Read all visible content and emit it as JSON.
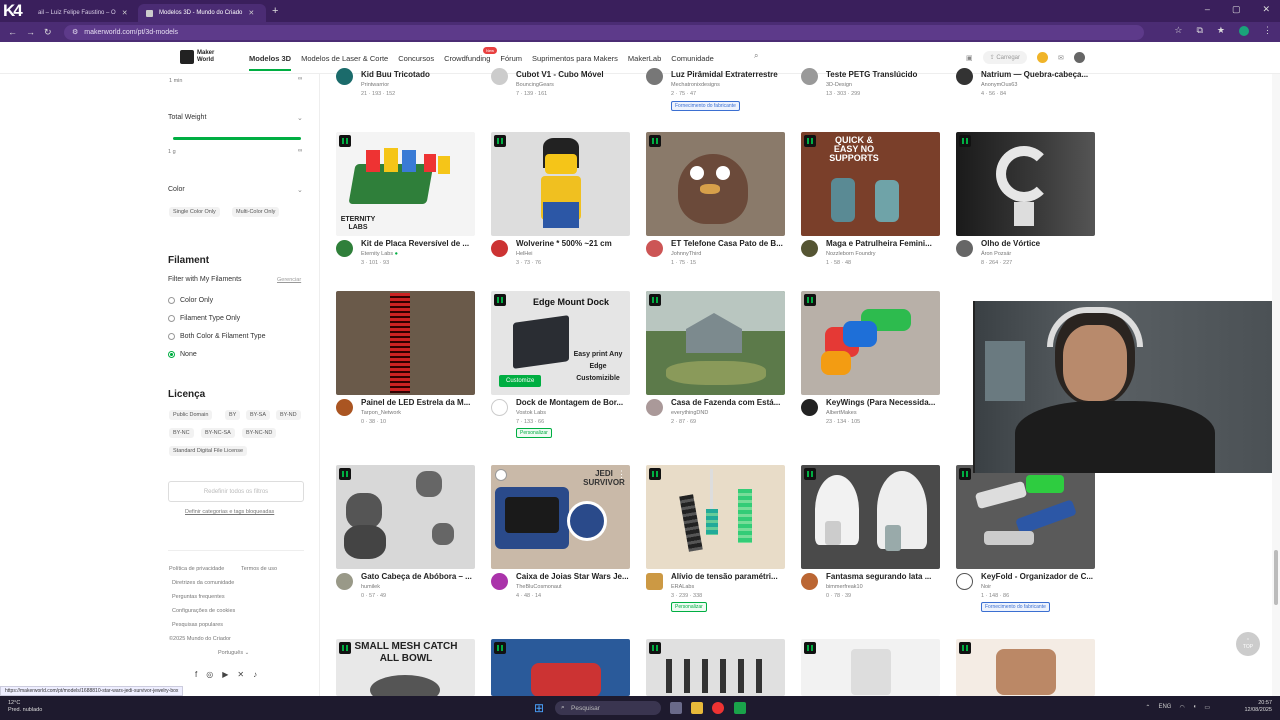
{
  "browser": {
    "tabs": [
      {
        "label": "ail – Luiz Felipe Faustino – O"
      },
      {
        "label": "Modelos 3D - Mundo do Criado"
      }
    ],
    "url": "makerworld.com/pt/3d-models"
  },
  "overlay_logo": "K4",
  "site": {
    "logo_line1": "Maker",
    "logo_line2": "World",
    "menu": [
      "Modelos 3D",
      "Modelos de Laser & Corte",
      "Concursos",
      "Crowdfunding",
      "Fórum",
      "Suprimentos para Makers",
      "MakerLab",
      "Comunidade"
    ],
    "new_badge": "New",
    "upload_label": "Carregar"
  },
  "sidebar": {
    "top_min": "1 min",
    "total_weight": "Total Weight",
    "weight_min": "1 g",
    "color": "Color",
    "color_chips": [
      "Single Color Only",
      "Multi-Color Only"
    ],
    "filament": "Filament",
    "filter_my": "Filter with My Filaments",
    "manage": "Gerenciar",
    "filament_options": [
      {
        "label": "Color Only",
        "selected": false
      },
      {
        "label": "Filament Type Only",
        "selected": false
      },
      {
        "label": "Both Color & Filament Type",
        "selected": false
      },
      {
        "label": "None",
        "selected": true
      }
    ],
    "license": "Licença",
    "license_chips": [
      "Public Domain",
      "BY",
      "BY-SA",
      "BY-ND",
      "BY-NC",
      "BY-NC-SA",
      "BY-NC-ND",
      "Standard Digital File License"
    ],
    "reset": "Redefinir todos os filtros",
    "define_blocked": "Definir categorias e tags bloqueadas",
    "footer_links": [
      "Política de privacidade",
      "Termos de uso",
      "Diretrizes da comunidade",
      "Perguntas frequentes",
      "Configurações de cookies",
      "Pesquisas populares"
    ],
    "copyright": "©2025 Mundo do Criador",
    "language": "Português"
  },
  "top_row": [
    {
      "title": "Kid Buu Tricotado",
      "author": "Printwarrior",
      "stats": "21 · 193 · 152",
      "tag": ""
    },
    {
      "title": "Cubot V1 - Cubo Móvel",
      "author": "BouncingGears",
      "stats": "7 · 139 · 161",
      "tag": ""
    },
    {
      "title": "Luz Pirâmidal Extraterrestre",
      "author": "Mechatronixdesigns",
      "stats": "2 · 75 · 47",
      "tag": "Fornecimento do fabricante"
    },
    {
      "title": "Teste PETG Translúcido",
      "author": "3D-Design",
      "stats": "13 · 303 · 299",
      "tag": ""
    },
    {
      "title": "Natrium — Quebra-cabeça...",
      "author": "AnonymOus63",
      "stats": "4 · 56 · 84",
      "tag": ""
    }
  ],
  "cards": [
    {
      "title": "Kit de Placa Reversível de ...",
      "author": "Eternity Labs",
      "stats": "3 · 101 · 93",
      "tag": "",
      "overlay": "ETERNITY LABS"
    },
    {
      "title": "Wolverine * 500% ~21 cm",
      "author": "HelHei",
      "stats": "3 · 73 · 76",
      "tag": "",
      "overlay": ""
    },
    {
      "title": "ET Telefone Casa Pato de B...",
      "author": "JohnnyThird",
      "stats": "1 · 75 · 15",
      "tag": "",
      "overlay": ""
    },
    {
      "title": "Maga e Patrulheira Femini...",
      "author": "Nozzleborn Foundry",
      "stats": "1 · 58 · 48",
      "tag": "",
      "overlay": "QUICK & EASY NO SUPPORTS"
    },
    {
      "title": "Olho de Vórtice",
      "author": "Áron Pozsár",
      "stats": "8 · 264 · 227",
      "tag": "",
      "overlay": ""
    },
    {
      "title": "Painel de LED Estrela da M...",
      "author": "Tarpon_Network",
      "stats": "0 · 38 · 10",
      "tag": "",
      "overlay": ""
    },
    {
      "title": "Dock de Montagem de Bor...",
      "author": "Vostok Labs",
      "stats": "7 · 133 · 66",
      "tag": "Personalizar",
      "overlay": "Edge Mount Dock",
      "customize": "Customize",
      "sub": "Easy print Any Edge Customizible"
    },
    {
      "title": "Casa de Fazenda com Está...",
      "author": "everythingDND",
      "stats": "2 · 87 · 69",
      "tag": "",
      "overlay": ""
    },
    {
      "title": "KeyWings (Para Necessida...",
      "author": "AlbertMakes",
      "stats": "23 · 134 · 105",
      "tag": "",
      "overlay": ""
    },
    {
      "title": "Gato Cabeça de Abóbora – ...",
      "author": "humilek",
      "stats": "0 · 57 · 49",
      "tag": "",
      "overlay": ""
    },
    {
      "title": "Caixa de Joias Star Wars Je...",
      "author": "TheBluCosmonaut",
      "stats": "4 · 48 · 14",
      "tag": "",
      "overlay": "JEDI SURVIVOR"
    },
    {
      "title": "Alívio de tensão paramétri...",
      "author": "ERALabs",
      "stats": "3 · 239 · 338",
      "tag": "Personalizar",
      "overlay": ""
    },
    {
      "title": "Fantasma segurando lata ...",
      "author": "bimmerfreak10",
      "stats": "0 · 78 · 39",
      "tag": "",
      "overlay": ""
    },
    {
      "title": "KeyFold - Organizador de C...",
      "author": "Noir",
      "stats": "1 · 148 · 86",
      "tag": "Fornecimento do fabricante",
      "overlay": ""
    }
  ],
  "bottom_overlay": "SMALL MESH CATCH ALL BOWL",
  "top_button": "TOP",
  "status_url": "https://makerworld.com/pt/models/1688810-star-wars-jedi-survivor-jewelry-box",
  "taskbar": {
    "temp": "12°C",
    "weather": "Pred. nublado",
    "search": "Pesquisar",
    "lang": "ENG",
    "time": "20:57",
    "date": "12/08/2025"
  }
}
